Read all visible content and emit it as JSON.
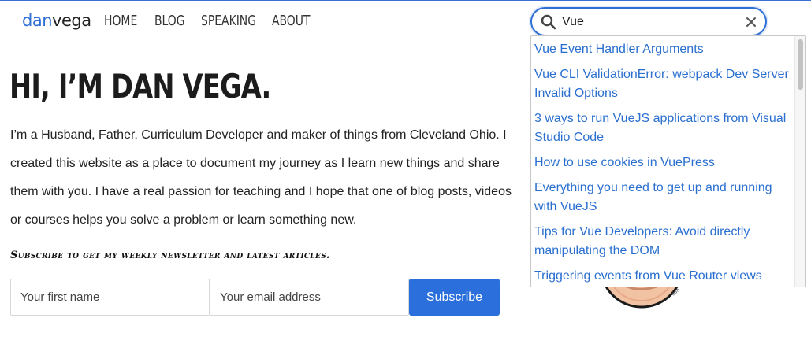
{
  "logo": {
    "part1": "dan",
    "part2": "vega"
  },
  "nav": [
    {
      "label": "HOME"
    },
    {
      "label": "BLOG"
    },
    {
      "label": "SPEAKING"
    },
    {
      "label": "ABOUT"
    }
  ],
  "hero": {
    "title": "HI, I’M DAN VEGA.",
    "intro": "I’m a Husband, Father, Curriculum Developer and maker of things from Cleveland Ohio. I created this website as a place to document my journey as I learn new things and share them with you. I have a real passion for teaching and I hope that one of blog posts, videos or courses helps you solve a problem or learn something new."
  },
  "newsletter": {
    "tagline": "Subscribe to get my weekly newsletter and latest articles.",
    "first_name_placeholder": "Your first name",
    "email_placeholder": "Your email address",
    "submit_label": "Subscribe"
  },
  "search": {
    "value": "Vue",
    "results": [
      "Vue Event Handler Arguments",
      "Vue CLI ValidationError: webpack Dev Server Invalid Options",
      "3 ways to run VueJS applications from Visual Studio Code",
      "How to use cookies in VuePress",
      "Everything you need to get up and running with VueJS",
      "Tips for Vue Developers: Avoid directly manipulating the DOM",
      "Triggering events from Vue Router views"
    ]
  },
  "colors": {
    "accent": "#2f6fd6",
    "link": "#2a6fd0",
    "button": "#2a6fdc"
  }
}
